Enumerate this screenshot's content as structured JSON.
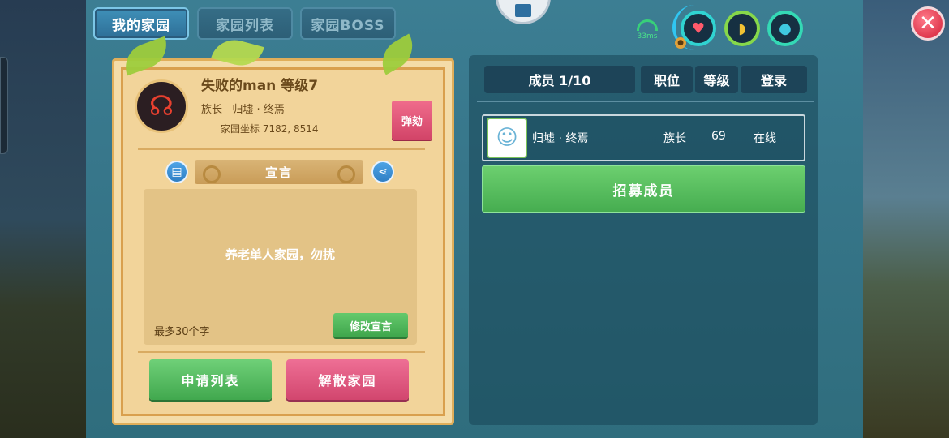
{
  "tabs": [
    {
      "label": "我的家园",
      "active": true
    },
    {
      "label": "家园列表",
      "active": false
    },
    {
      "label": "家园BOSS",
      "active": false
    }
  ],
  "status": {
    "ping": "33ms",
    "icons": [
      "heart-icon",
      "hunger-icon",
      "water-drop-icon"
    ]
  },
  "home": {
    "name_level": "失败的man 等级7",
    "role_owner": "族长   归墟 · 终焉",
    "coords": "家园坐标 7182, 8514",
    "impeach_label": "弹劾",
    "declaration_title": "宣言",
    "declaration_text": "养老单人家园，勿扰",
    "limit_text": "最多30个字",
    "edit_label": "修改宣言",
    "apply_list_label": "申请列表",
    "dissolve_label": "解散家园"
  },
  "members": {
    "header_count": "成员 1/10",
    "header_position": "职位",
    "header_level": "等级",
    "header_login": "登录",
    "rows": [
      {
        "name": "归墟 · 终焉",
        "role": "族长",
        "level": "69",
        "status": "在线"
      }
    ],
    "recruit_label": "招募成员"
  },
  "colors": {
    "panel": "#3c7e93",
    "parchment": "#f2d49a",
    "green_button": "#46ad50",
    "pink_button": "#d2466e",
    "close": "#e03a4f"
  }
}
